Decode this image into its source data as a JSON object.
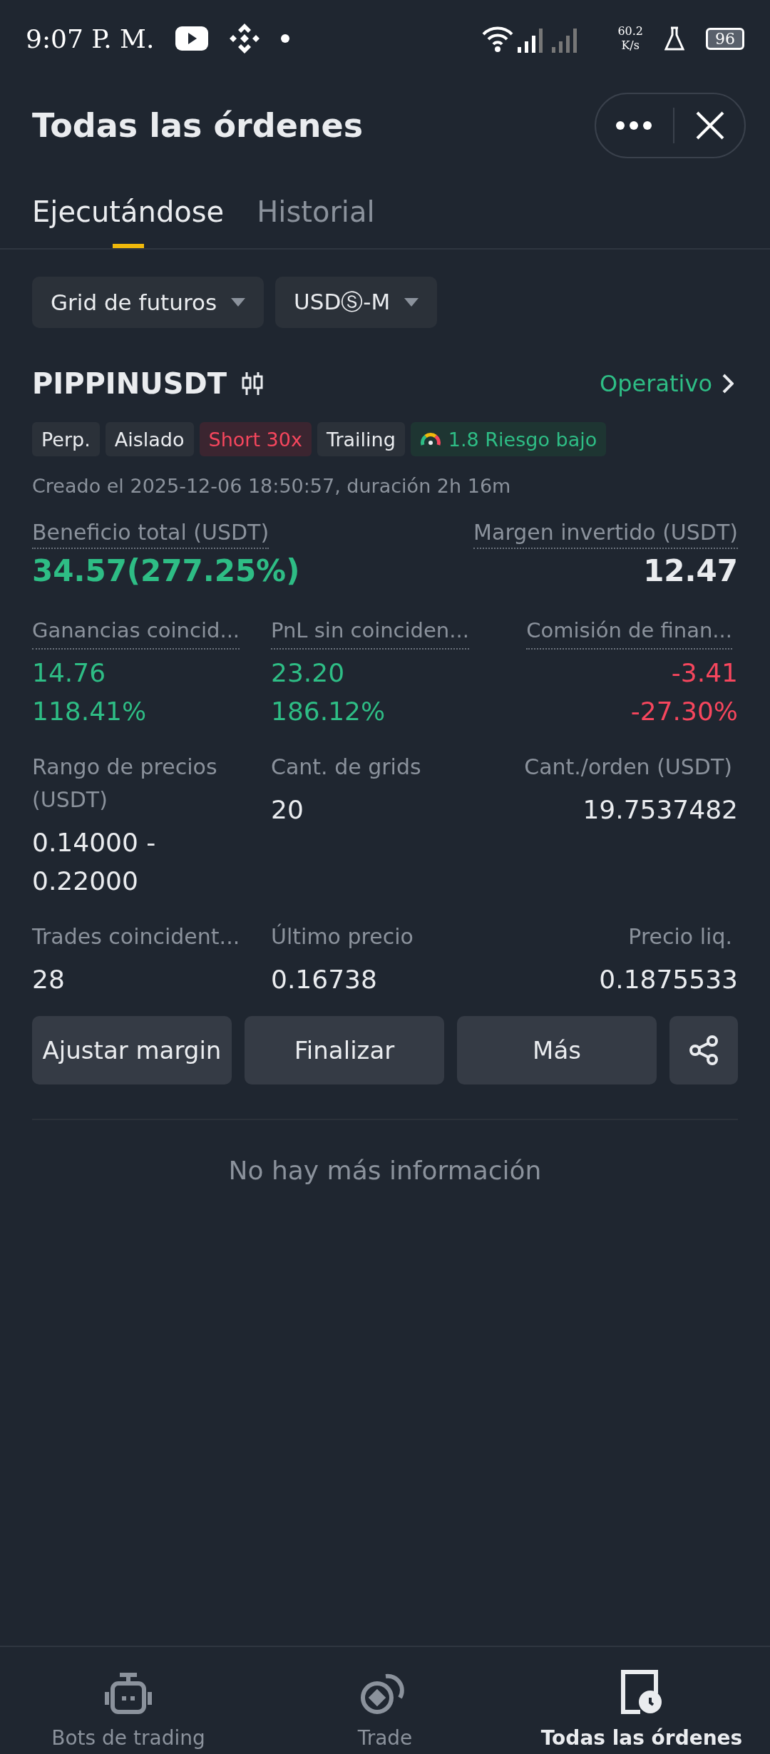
{
  "status_bar": {
    "time": "9:07 P. M.",
    "speed": "60.2",
    "speed_unit": "K/s",
    "battery": "96"
  },
  "header": {
    "title": "Todas las órdenes"
  },
  "tabs": [
    {
      "label": "Ejecutándose",
      "selected": true
    },
    {
      "label": "Historial",
      "selected": false
    }
  ],
  "filters": [
    {
      "label": "Grid de futuros"
    },
    {
      "label": "USDⓈ-M"
    }
  ],
  "order": {
    "pair": "PIPPINUSDT",
    "status": "Operativo",
    "tags": [
      {
        "kind": "plain",
        "label": "Perp."
      },
      {
        "kind": "plain",
        "label": "Aislado"
      },
      {
        "kind": "danger",
        "label": "Short 30x"
      },
      {
        "kind": "plain",
        "label": "Trailing"
      },
      {
        "kind": "risk",
        "label": "1.8 Riesgo bajo"
      }
    ],
    "created": "Creado el 2025-12-06 18:50:57, duración 2h 16m",
    "summary": [
      {
        "label": "Beneficio total (USDT)",
        "value": "34.57(277.25%)",
        "color": "#2ebd85"
      },
      {
        "label": "Margen invertido (USDT)",
        "value": "12.47",
        "color": "#eaecef"
      }
    ],
    "metric_rows": [
      [
        {
          "label": "Ganancias coincid...",
          "underlined": true,
          "values": [
            "14.76",
            "118.41%"
          ],
          "color": "#2ebd85"
        },
        {
          "label": "PnL sin coinciden...",
          "underlined": true,
          "values": [
            "23.20",
            "186.12%"
          ],
          "color": "#2ebd85"
        },
        {
          "label": "Comisión de finan...",
          "underlined": true,
          "values": [
            "-3.41",
            "-27.30%"
          ],
          "color": "#f6465d"
        }
      ],
      [
        {
          "label": "Rango de precios (USDT)",
          "underlined": false,
          "values": [
            "0.14000 -",
            "0.22000"
          ],
          "color": "#eaecef"
        },
        {
          "label": "Cant. de grids",
          "underlined": false,
          "values": [
            "20"
          ],
          "color": "#eaecef"
        },
        {
          "label": "Cant./orden (USDT)",
          "underlined": false,
          "values": [
            "19.7537482"
          ],
          "color": "#eaecef"
        }
      ],
      [
        {
          "label": "Trades coincident...",
          "underlined": false,
          "values": [
            "28"
          ],
          "color": "#eaecef"
        },
        {
          "label": "Último precio",
          "underlined": false,
          "values": [
            "0.16738"
          ],
          "color": "#eaecef"
        },
        {
          "label": "Precio liq.",
          "underlined": false,
          "values": [
            "0.1875533"
          ],
          "color": "#eaecef"
        }
      ]
    ],
    "actions": [
      {
        "label": "Ajustar margin"
      },
      {
        "label": "Finalizar"
      },
      {
        "label": "Más"
      }
    ]
  },
  "empty_note": "No hay más información",
  "bottom_nav": [
    {
      "label": "Bots de trading",
      "selected": false
    },
    {
      "label": "Trade",
      "selected": false
    },
    {
      "label": "Todas las órdenes",
      "selected": true
    }
  ]
}
